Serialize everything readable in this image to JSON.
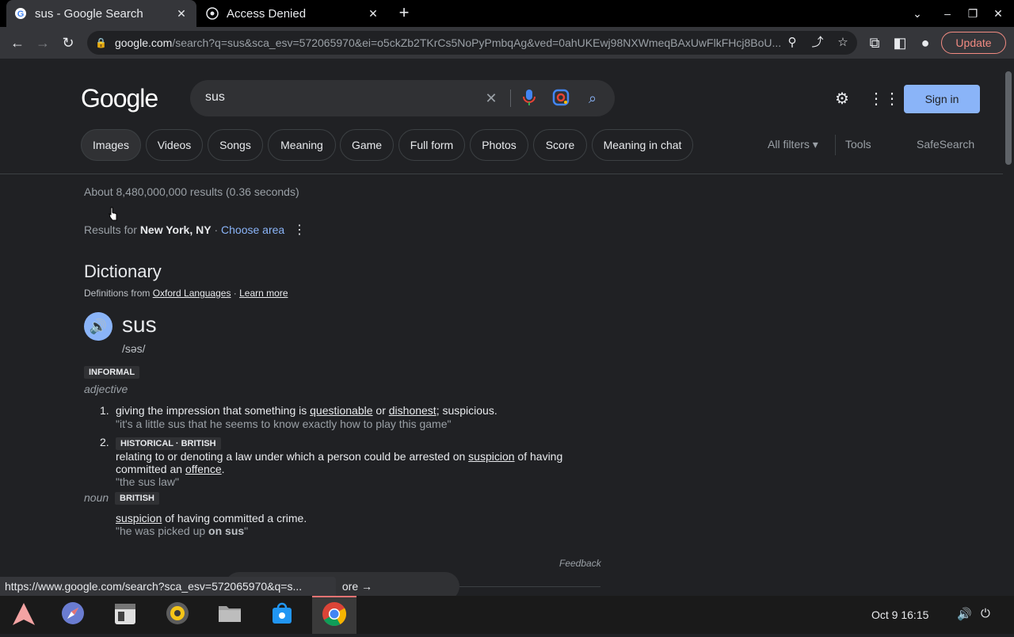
{
  "browser": {
    "tabs": [
      {
        "title": "sus - Google Search",
        "favicon": "google-g-icon",
        "active": true
      },
      {
        "title": "Access Denied",
        "favicon": "generic-site-icon",
        "active": false
      }
    ],
    "url_host": "google.com",
    "url_path": "/search?q=sus&sca_esv=572065970&ei=o5ckZb2TKrCs5NoPyPmbqAg&ved=0ahUKEwj98NXWmeqBAxUwFlkFHcj8BoU...",
    "update_label": "Update",
    "status_url": "https://www.google.com/search?sca_esv=572065970&q=s..."
  },
  "google": {
    "logo_text": "Google",
    "query": "sus",
    "signin_label": "Sign in",
    "chips": [
      "Images",
      "Videos",
      "Songs",
      "Meaning",
      "Game",
      "Full form",
      "Photos",
      "Score",
      "Meaning in chat"
    ],
    "all_filters": "All filters",
    "tools": "Tools",
    "safesearch": "SafeSearch",
    "stats": "About 8,480,000,000 results (0.36 seconds)",
    "results_for_prefix": "Results for ",
    "location": "New York, NY",
    "choose_area": "Choose area"
  },
  "dictionary": {
    "title": "Dictionary",
    "source_prefix": "Definitions from ",
    "source_link": "Oxford Languages",
    "learn_more": "Learn more",
    "word": "sus",
    "phonetic": "/səs/",
    "register_tag": "INFORMAL",
    "pos_adj": "adjective",
    "def1_num": "1.",
    "def1_a": "giving the impression that something is ",
    "def1_link1": "questionable",
    "def1_b": " or ",
    "def1_link2": "dishonest",
    "def1_c": "; suspicious.",
    "def1_example": "\"it's a little sus that he seems to know exactly how to play this game\"",
    "def2_num": "2.",
    "def2_tag": "HISTORICAL · BRITISH",
    "def2_a": "relating to or denoting a law under which a person could be arrested on ",
    "def2_link1": "suspicion",
    "def2_b": " of having",
    "def2_c": "committed an ",
    "def2_link2": "offence",
    "def2_d": ".",
    "def2_example": "\"the sus law\"",
    "pos_noun": "noun",
    "noun_tag": "BRITISH",
    "noun_link": "suspicion",
    "noun_def": " of having committed a crime.",
    "noun_example_a": "\"he was picked up ",
    "noun_example_b": "on sus",
    "noun_example_c": "\"",
    "feedback": "Feedback",
    "more_label": "ore"
  },
  "taskbar": {
    "date": "Oct 9",
    "time": "16:15",
    "apps": [
      "arch-launcher-icon",
      "compass-browser-icon",
      "calendar-icon",
      "disk-icon",
      "files-icon",
      "store-icon",
      "chrome-icon"
    ]
  }
}
